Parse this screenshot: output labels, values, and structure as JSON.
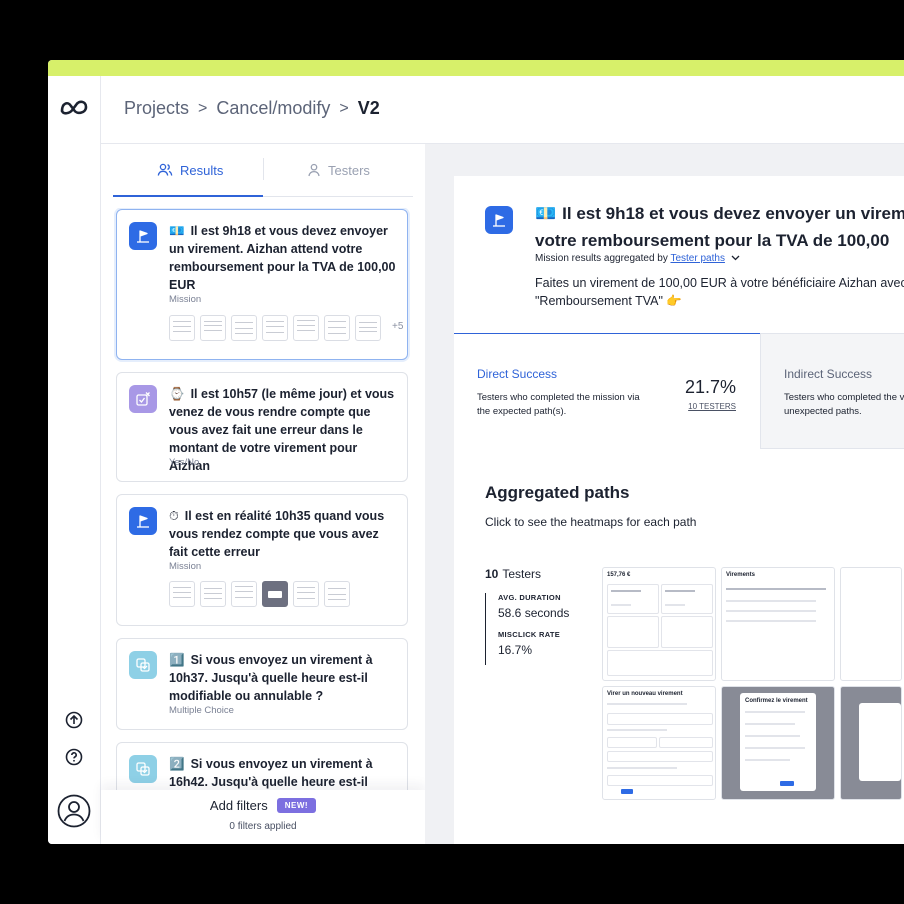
{
  "colors": {
    "accent": "#2f63d8",
    "topbar": "#d7f06a",
    "mission_icon": "#2e6be5",
    "yesno_icon": "#a898e6",
    "choice_icon": "#8ed0e6",
    "new_badge": "#7c6fe0"
  },
  "rail": {
    "logo_icon": "maze-logo-icon",
    "icons": [
      "upload-icon",
      "help-icon",
      "user-avatar-icon"
    ]
  },
  "breadcrumb": {
    "projects": "Projects",
    "sep": ">",
    "study": "Cancel/modify",
    "version": "V2"
  },
  "tabs": {
    "results": "Results",
    "testers": "Testers"
  },
  "cards": [
    {
      "emoji": "💶",
      "title": "Il est 9h18 et vous devez envoyer un virement. Aizhan attend votre remboursement pour la TVA de 100,00 EUR",
      "type": "Mission",
      "more": "+5"
    },
    {
      "emoji": "⌚",
      "title": "Il est 10h57 (le même jour) et vous venez de vous rendre compte que vous avez fait une erreur dans le montant de votre virement pour Aizhan",
      "type": "Yes/No"
    },
    {
      "emoji": "⏱",
      "title": "Il est en réalité 10h35 quand vous vous rendez compte que vous avez fait cette erreur",
      "type": "Mission"
    },
    {
      "emoji": "1️⃣",
      "title": "Si vous envoyez un virement à 10h37. Jusqu'à quelle heure est-il modifiable ou annulable ?",
      "type": "Multiple Choice"
    },
    {
      "emoji": "2️⃣",
      "title": "Si vous envoyez un virement à 16h42. Jusqu'à quelle heure est-il",
      "type": ""
    }
  ],
  "filters": {
    "label": "Add filters",
    "badge": "NEW!",
    "applied": "0 filters applied"
  },
  "detail": {
    "emoji": "💶",
    "title_line1": "Il est 9h18 et vous devez envoyer un virem",
    "title_line2": "votre remboursement pour la TVA de 100,00",
    "aggregated_by": "Mission results aggregated by",
    "tester_paths": "Tester paths",
    "desc_line1": "Faites un virement de 100,00 EUR à votre bénéficiaire Aizhan avec",
    "desc_line2": "\"Remboursement TVA\" 👉",
    "direct": {
      "label": "Direct Success",
      "text": "Testers who completed the mission via the expected path(s).",
      "pct": "21.7%",
      "testers": "10 TESTERS"
    },
    "indirect": {
      "label": "Indirect Success",
      "text": "Testers who completed the via unexpected paths."
    },
    "paths_title": "Aggregated paths",
    "paths_sub": "Click to see the heatmaps for each path",
    "testers_count": "10",
    "testers_label": "Testers",
    "avg_label": "AVG. DURATION",
    "avg_value": "58.6 seconds",
    "misclick_label": "MISCLICK RATE",
    "misclick_value": "16.7%",
    "shot_texts": {
      "amount": "157,76 €",
      "virements": "Virements",
      "new_transfer": "Virer un nouveau virement",
      "confirm": "Confirmez le virement"
    }
  }
}
